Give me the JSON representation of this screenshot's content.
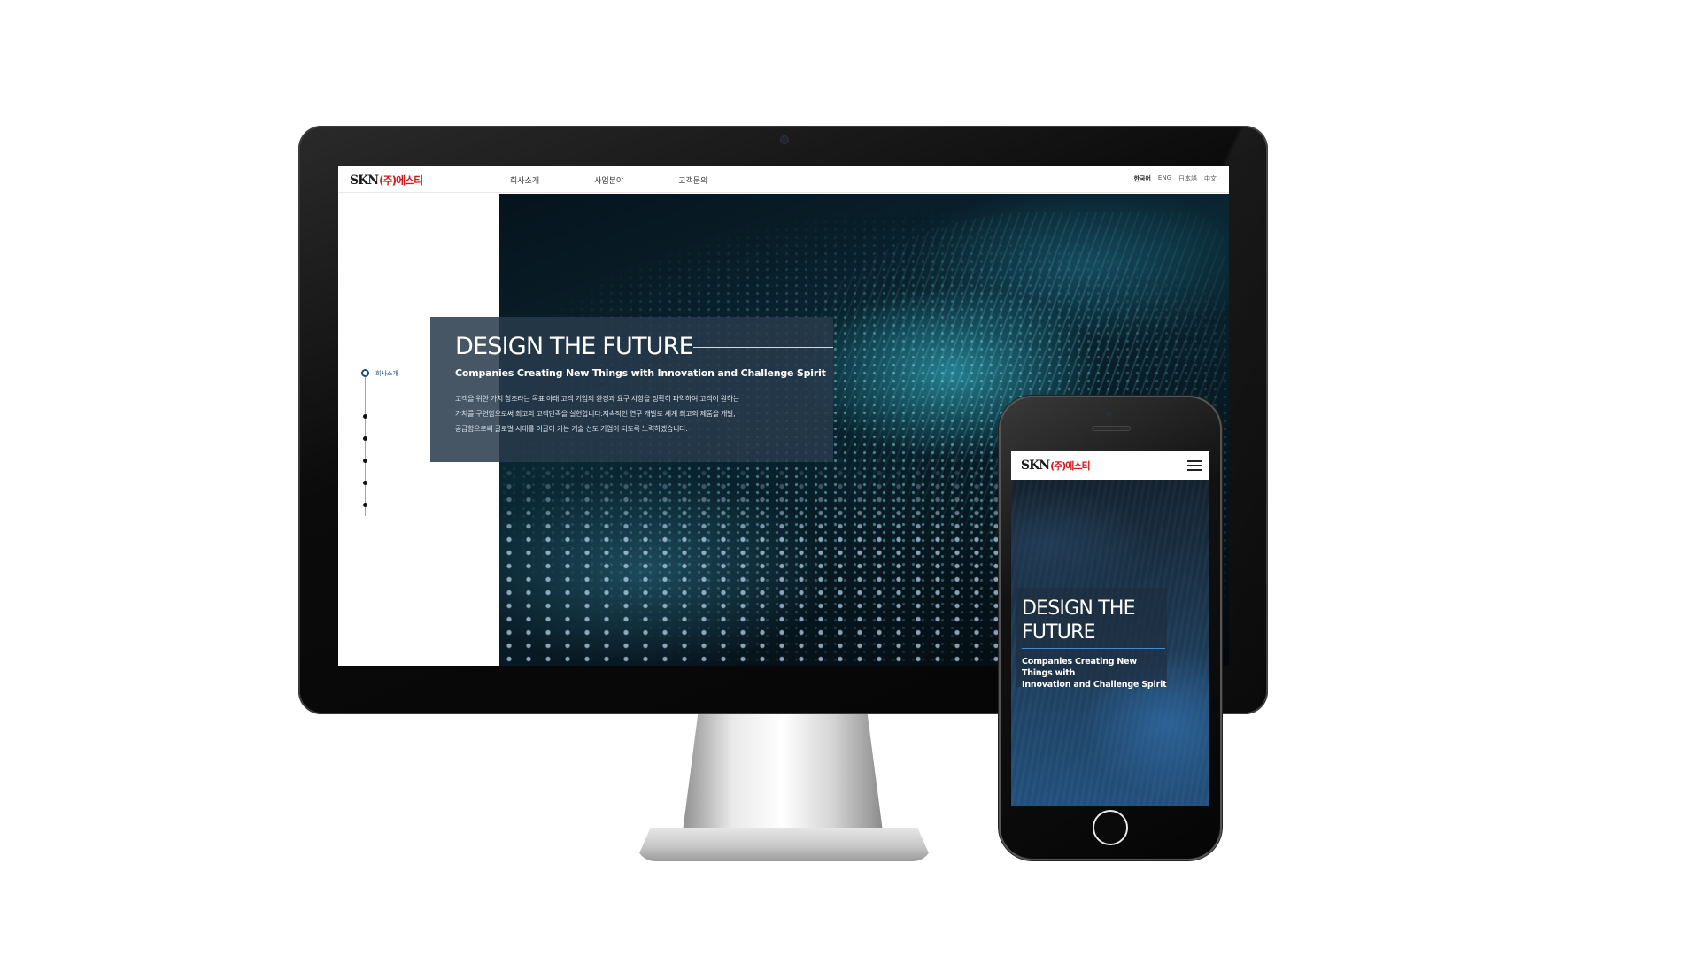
{
  "desktop": {
    "logo": {
      "mark": "SKN",
      "name": "(주)에스티"
    },
    "nav": {
      "items": [
        "회사소개",
        "사업분야",
        "고객문의"
      ]
    },
    "languages": [
      "한국어",
      "ENG",
      "日本語",
      "中文"
    ],
    "side_nav": {
      "active_label": "회사소개",
      "dot_count": 5
    },
    "hero": {
      "title": "DESIGN THE FUTURE",
      "subtitle": "Companies Creating New Things with Innovation and Challenge Spirit",
      "description": [
        "고객을 위한 가치 창조라는 목표 아래 고객 기업의 환경과 요구 사항을 정확히 파악하여 고객이 원하는",
        "가치를 구현함으로써 최고의 고객만족을 실현합니다.지속적인 연구 개발로 세계 최고의 제품을 개발,",
        "공급함으로써 글로벌 시대를 이끌어 가는 기술 선도 기업이 되도록 노력하겠습니다."
      ]
    }
  },
  "mobile": {
    "logo": {
      "mark": "SKN",
      "name": "(주)에스티"
    },
    "menu_icon": "hamburger-icon",
    "hero": {
      "title_line1": "DESIGN THE",
      "title_line2": "FUTURE",
      "subtitle_line1": "Companies Creating New Things with",
      "subtitle_line2": "Innovation and Challenge Spirit"
    }
  },
  "colors": {
    "brand_red": "#d7191c",
    "accent_blue": "#1f4d73",
    "hero_overlay": "#283a4c",
    "mobile_line": "#3b8fd4"
  }
}
